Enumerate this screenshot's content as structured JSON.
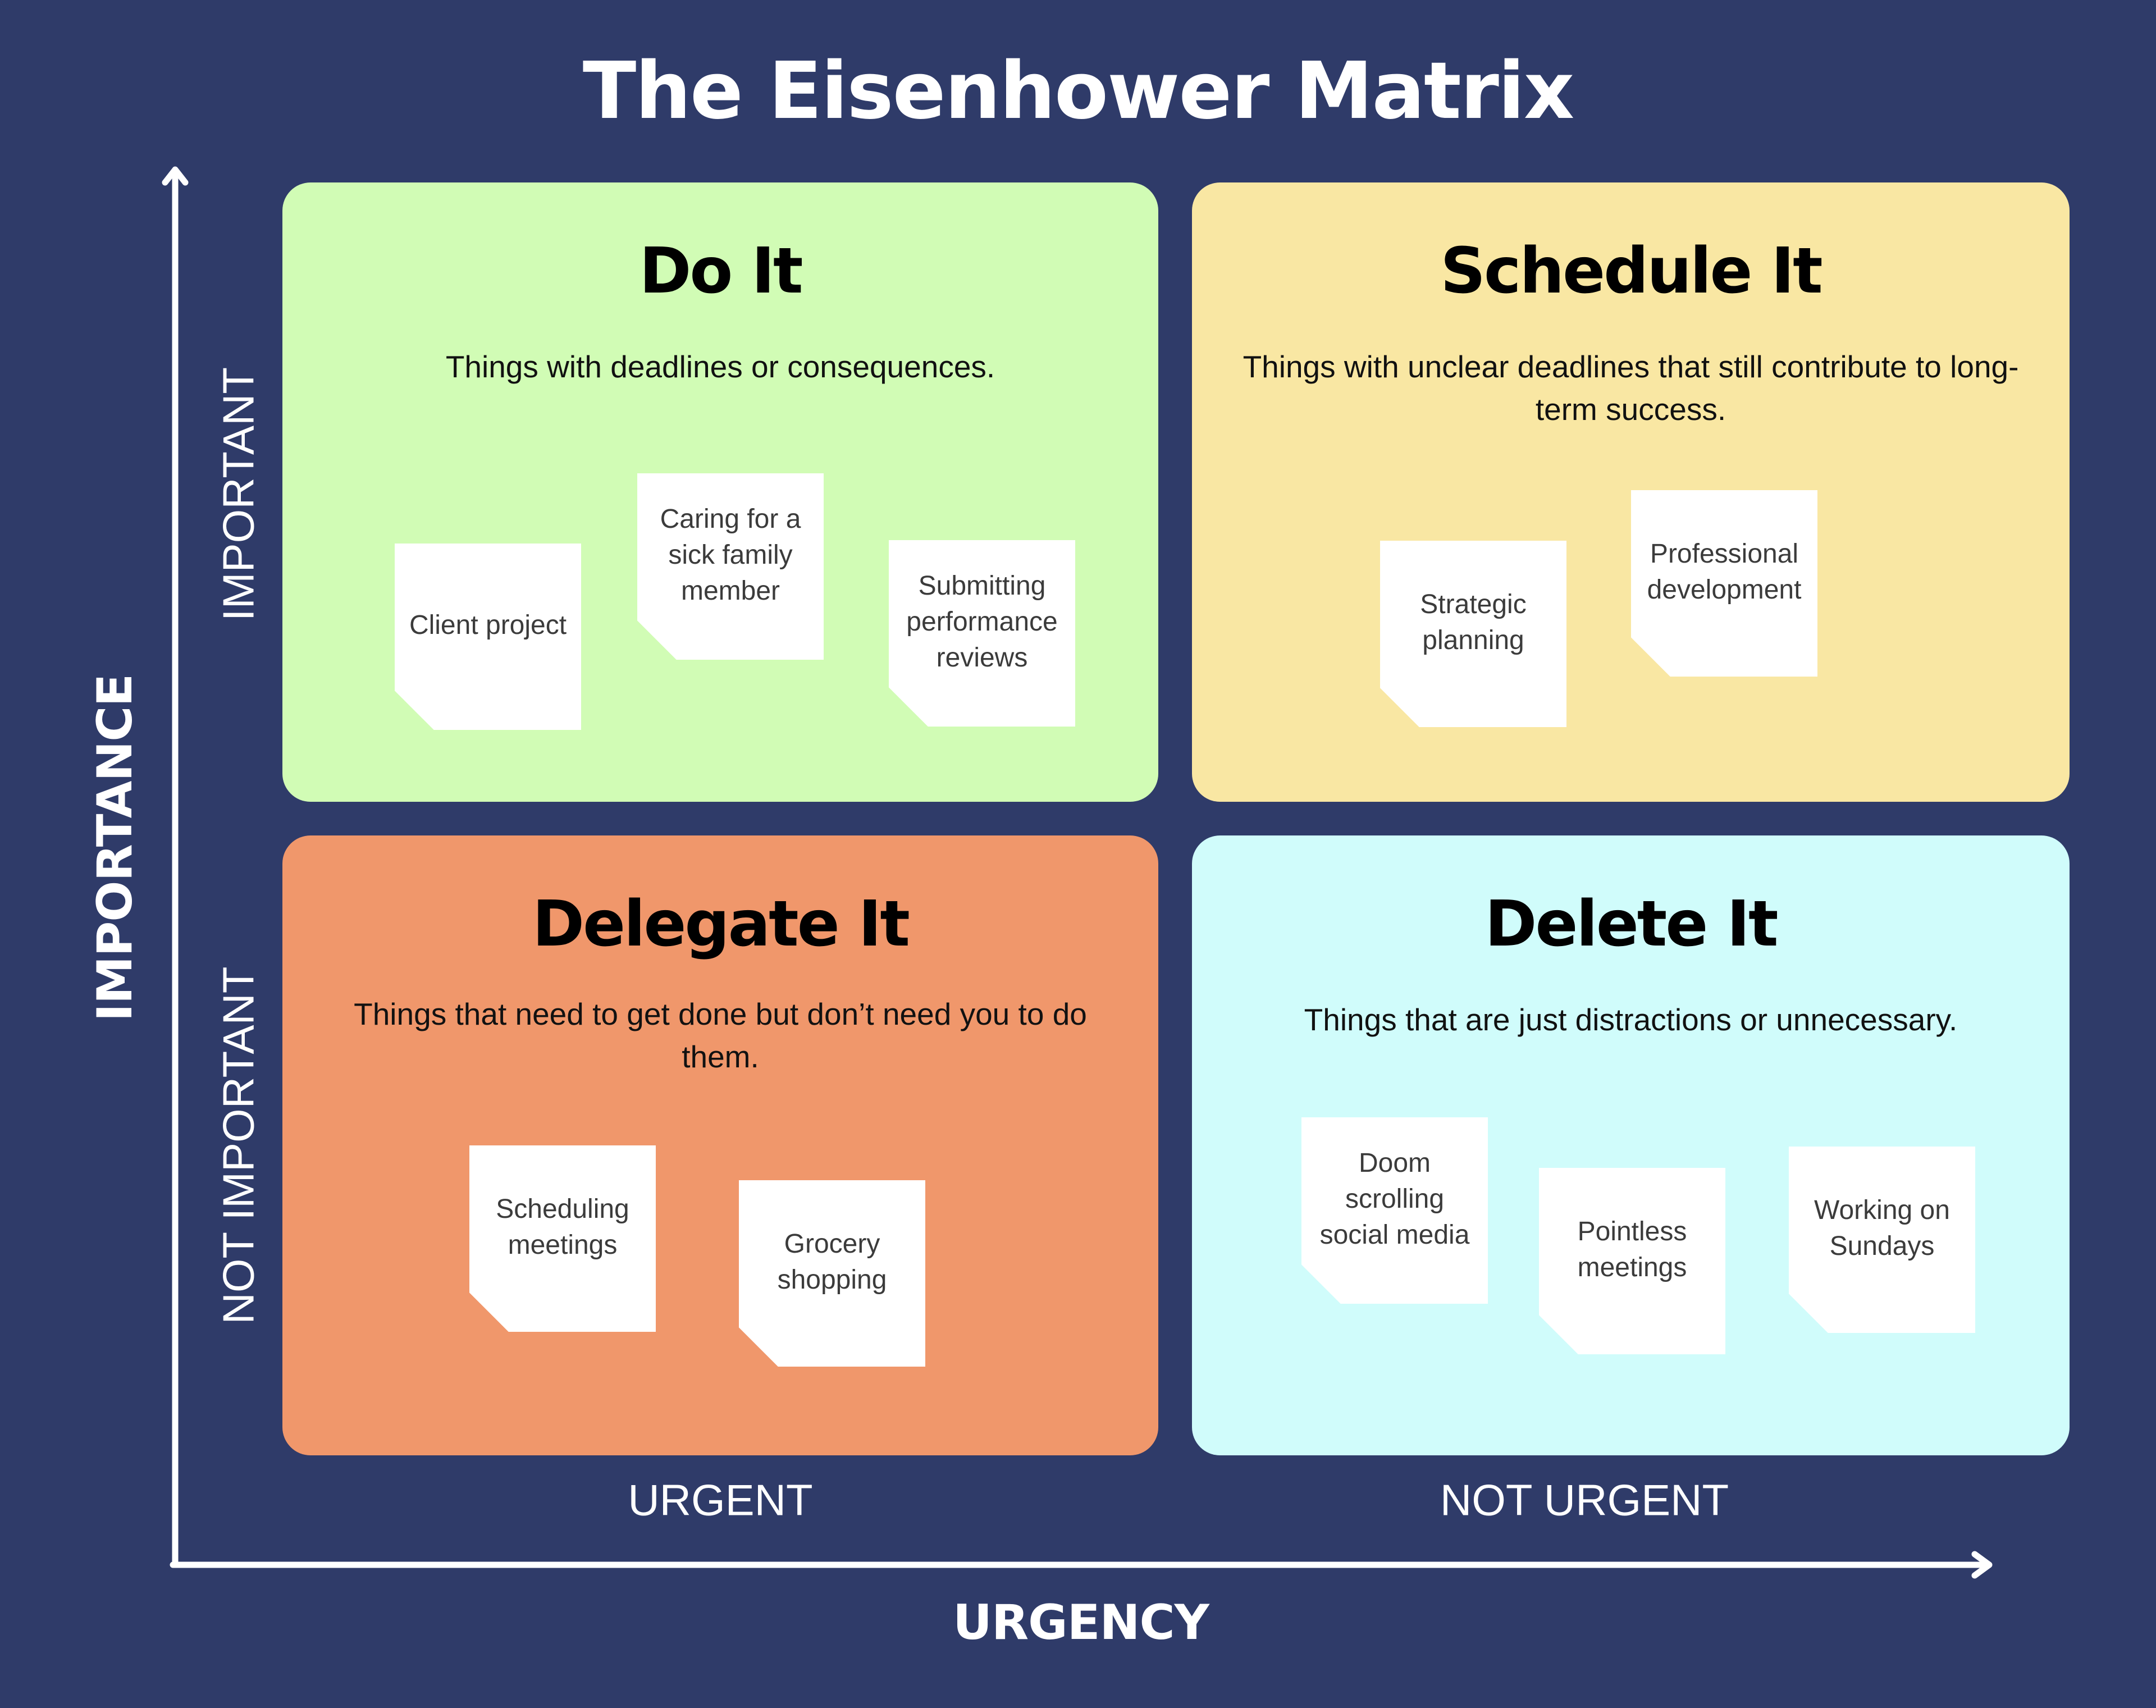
{
  "title": "The Eisenhower Matrix",
  "axes": {
    "y_axis_title": "IMPORTANCE",
    "y_high_label": "IMPORTANT",
    "y_low_label": "NOT IMPORTANT",
    "x_axis_title": "URGENCY",
    "x_left_label": "URGENT",
    "x_right_label": "NOT URGENT"
  },
  "colors": {
    "background": "#2f3b69",
    "do_it": "#d1fcb5",
    "schedule_it": "#f9e7a3",
    "delegate_it": "#f0976b",
    "delete_it": "#d0fcfb",
    "note": "#ffffff"
  },
  "quadrants": [
    {
      "key": "do_it",
      "title": "Do It",
      "description": "Things with deadlines or consequences.",
      "notes": [
        "Client project",
        "Caring for a sick family member",
        "Submitting performance reviews"
      ]
    },
    {
      "key": "schedule_it",
      "title": "Schedule It",
      "description": "Things with unclear deadlines that still contribute to long-term success.",
      "notes": [
        "Strategic planning",
        "Professional development"
      ]
    },
    {
      "key": "delegate_it",
      "title": "Delegate It",
      "description": "Things that need to get done but don’t need you to do them.",
      "notes": [
        "Scheduling meetings",
        "Grocery shopping"
      ]
    },
    {
      "key": "delete_it",
      "title": "Delete It",
      "description": "Things that are just distractions or unnecessary.",
      "notes": [
        "Doom scrolling social media",
        "Pointless meetings",
        "Working on Sundays"
      ]
    }
  ]
}
